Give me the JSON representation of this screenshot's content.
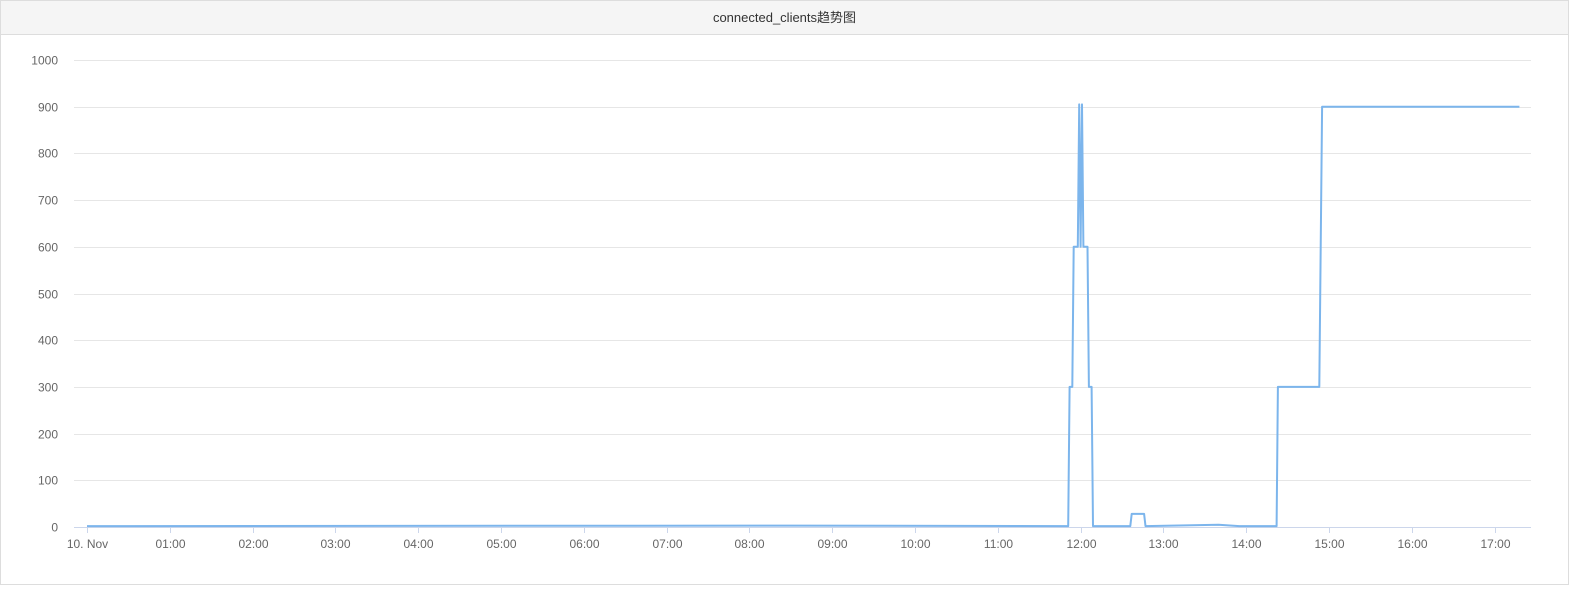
{
  "panel": {
    "title": "connected_clients趋势图"
  },
  "chart_data": {
    "type": "line",
    "title": "connected_clients趋势图",
    "xlabel": "",
    "ylabel": "",
    "ylim": [
      0,
      1000
    ],
    "yticks": [
      0,
      100,
      200,
      300,
      400,
      500,
      600,
      700,
      800,
      900,
      1000
    ],
    "xlim": [
      "00:00",
      "17:30"
    ],
    "xticks": [
      {
        "t": "00:00",
        "label": "10. Nov"
      },
      {
        "t": "01:00",
        "label": "01:00"
      },
      {
        "t": "02:00",
        "label": "02:00"
      },
      {
        "t": "03:00",
        "label": "03:00"
      },
      {
        "t": "04:00",
        "label": "04:00"
      },
      {
        "t": "05:00",
        "label": "05:00"
      },
      {
        "t": "06:00",
        "label": "06:00"
      },
      {
        "t": "07:00",
        "label": "07:00"
      },
      {
        "t": "08:00",
        "label": "08:00"
      },
      {
        "t": "09:00",
        "label": "09:00"
      },
      {
        "t": "10:00",
        "label": "10:00"
      },
      {
        "t": "11:00",
        "label": "11:00"
      },
      {
        "t": "12:00",
        "label": "12:00"
      },
      {
        "t": "13:00",
        "label": "13:00"
      },
      {
        "t": "14:00",
        "label": "14:00"
      },
      {
        "t": "15:00",
        "label": "15:00"
      },
      {
        "t": "16:00",
        "label": "16:00"
      },
      {
        "t": "17:00",
        "label": "17:00"
      }
    ],
    "grid": true,
    "legend": "none",
    "series": [
      {
        "color": "#7cb5ec",
        "points": [
          [
            "00:00",
            2
          ],
          [
            "08:30",
            3
          ],
          [
            "11:51",
            2
          ],
          [
            "11:52",
            300
          ],
          [
            "11:54",
            300
          ],
          [
            "11:55",
            600
          ],
          [
            "11:58",
            600
          ],
          [
            "11:59",
            905
          ],
          [
            "12:00",
            600
          ],
          [
            "12:01",
            905
          ],
          [
            "12:02",
            600
          ],
          [
            "12:05",
            600
          ],
          [
            "12:06",
            300
          ],
          [
            "12:08",
            300
          ],
          [
            "12:09",
            2
          ],
          [
            "12:36",
            2
          ],
          [
            "12:37",
            28
          ],
          [
            "12:46",
            28
          ],
          [
            "12:47",
            2
          ],
          [
            "13:40",
            5
          ],
          [
            "13:55",
            2
          ],
          [
            "14:22",
            2
          ],
          [
            "14:23",
            300
          ],
          [
            "14:53",
            300
          ],
          [
            "14:55",
            900
          ],
          [
            "17:18",
            900
          ]
        ]
      }
    ]
  }
}
